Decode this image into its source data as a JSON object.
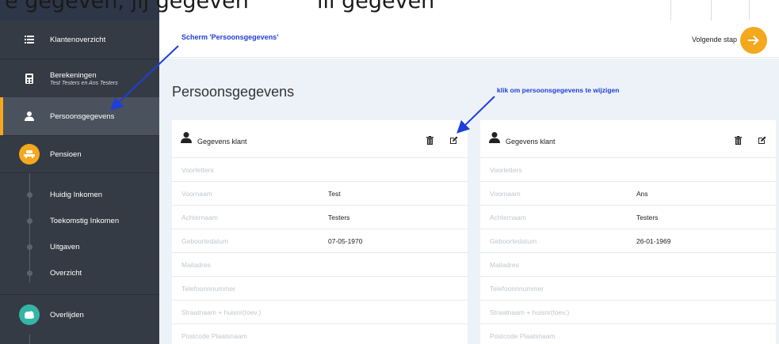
{
  "top_caption": {
    "left": "e gegeven, jij gegeven",
    "right": "iii gegeven"
  },
  "sidebar": {
    "items": [
      {
        "label": "Klantenoverzicht"
      },
      {
        "label": "Berekeningen",
        "sub": "Test Testers en Ans Testers"
      },
      {
        "label": "Persoonsgegevens"
      },
      {
        "label": "Pensioen"
      },
      {
        "label": "Huidig Inkomen"
      },
      {
        "label": "Toekomstig Inkomen"
      },
      {
        "label": "Uitgaven"
      },
      {
        "label": "Overzicht"
      },
      {
        "label": "Overlijden"
      }
    ]
  },
  "header": {
    "annotation": "Scherm 'Persoonsgegevens'",
    "next_label": "Volgende stap",
    "next_icon": "arrow-right"
  },
  "main": {
    "title": "Persoonsgegevens",
    "annotation": "klik om persoonsgegevens te wijzigen",
    "cards": [
      {
        "title": "Gegevens klant",
        "rows": [
          {
            "label": "Voorletters",
            "value": ""
          },
          {
            "label": "Voornaam",
            "value": "Test"
          },
          {
            "label": "Achternaam",
            "value": "Testers"
          },
          {
            "label": "Geboortedatum",
            "value": "07-05-1970"
          },
          {
            "label": "Mailadres",
            "value": ""
          },
          {
            "label": "Telefoonnnummer",
            "value": ""
          },
          {
            "label": "Straatnaam + huisnr(toev.)",
            "value": ""
          },
          {
            "label": "Postcode Plaatsnaam",
            "value": ""
          }
        ]
      },
      {
        "title": "Gegevens klant",
        "rows": [
          {
            "label": "Voorletters",
            "value": ""
          },
          {
            "label": "Voornaam",
            "value": "Ans"
          },
          {
            "label": "Achternaam",
            "value": "Testers"
          },
          {
            "label": "Geboortedatum",
            "value": "26-01-1969"
          },
          {
            "label": "Mailadres",
            "value": ""
          },
          {
            "label": "Telefoonnnummer",
            "value": ""
          },
          {
            "label": "Straatnaam + huisnr(toev.)",
            "value": ""
          },
          {
            "label": "Postcode Plaatsnaam",
            "value": ""
          }
        ]
      }
    ]
  },
  "colors": {
    "sidebar": "#353b45",
    "accent": "#f4a81d",
    "annotation": "#1f3fd8",
    "teal": "#35b5a5",
    "page_bg": "#edf2f8"
  }
}
